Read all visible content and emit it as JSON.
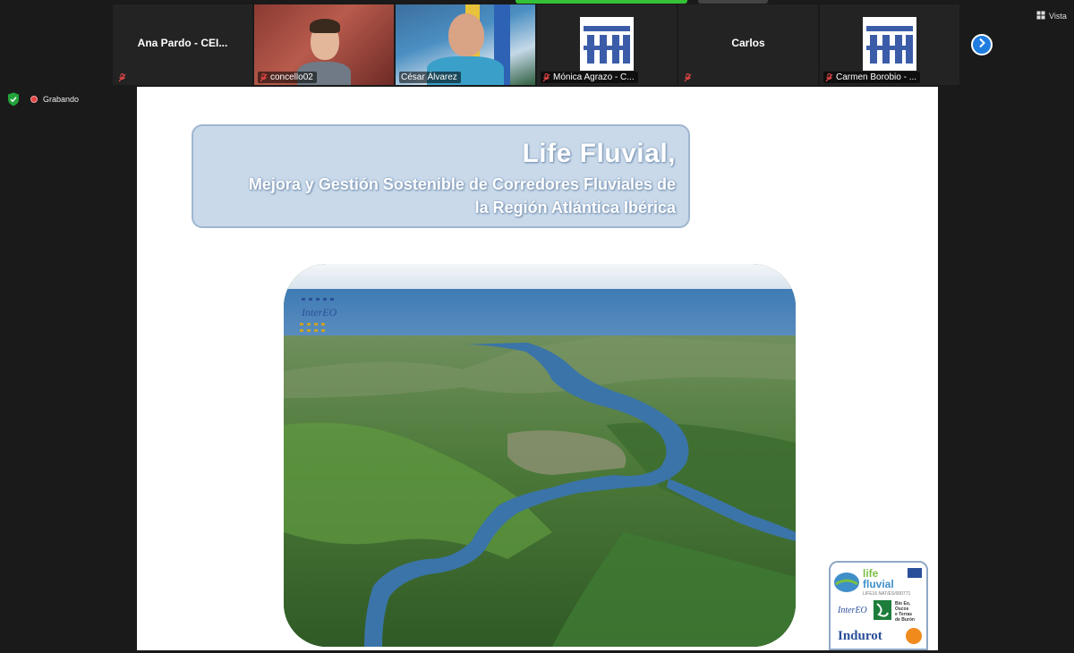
{
  "gallery": {
    "participants": [
      {
        "id": "p1",
        "name": "Ana Pardo - CEI...",
        "caption": "",
        "muted": true,
        "video": false
      },
      {
        "id": "p2",
        "name": "",
        "caption": "concello02",
        "muted": true,
        "video": true
      },
      {
        "id": "p3",
        "name": "",
        "caption": "César Álvarez",
        "muted": false,
        "video": true,
        "active": true
      },
      {
        "id": "p4",
        "name": "",
        "caption": "Mónica Agrazo - C...",
        "muted": true,
        "video": false,
        "logo": true
      },
      {
        "id": "p5",
        "name": "Carlos",
        "caption": "",
        "muted": true,
        "video": false
      },
      {
        "id": "p6",
        "name": "",
        "caption": "Carmen Borobio - ...",
        "muted": true,
        "video": false,
        "logo": true
      }
    ],
    "view_label": "Vista"
  },
  "recording": {
    "label": "Grabando"
  },
  "slide": {
    "title": "Life Fluvial,",
    "subtitle_line1": "Mejora y Gestión Sostenible de Corredores Fluviales de",
    "subtitle_line2": "la Región Atlántica Ibérica",
    "photo_logo_text": "InterEO",
    "corner_logo": {
      "brand_line1": "life",
      "brand_line2": "fluvial",
      "code": "LIFE16 NAT/ES/000771",
      "partner1": "InterEO",
      "partner2_line1": "Bio Eo,",
      "partner2_line2": "Oscos",
      "partner2_line3": "e Terras",
      "partner2_line4": "de Burón",
      "partner3": "Indurot"
    }
  },
  "colors": {
    "active_border": "#2fc12f",
    "accent_blue": "#1f7de0",
    "slide_title_box": "#c9d9ea",
    "recording_red": "#e24545"
  }
}
